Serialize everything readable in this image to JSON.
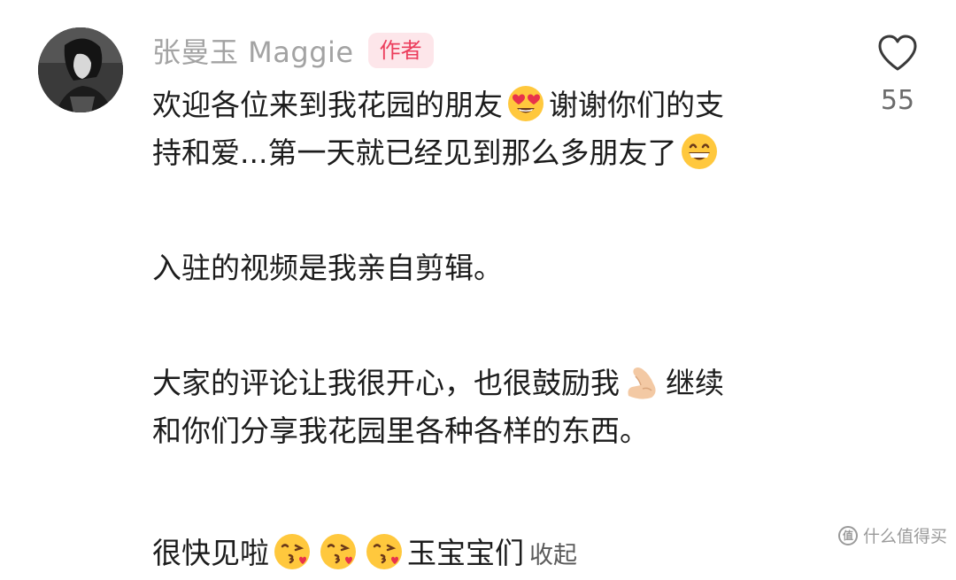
{
  "comment": {
    "author": {
      "name": "张曼玉 Maggie",
      "badge": "作者"
    },
    "lines": {
      "l1_a": "欢迎各位来到我花园的朋友",
      "l1_b": "谢谢你们的支",
      "l2": "持和爱...第一天就已经见到那么多朋友了",
      "l3": "入驻的视频是我亲自剪辑。",
      "l4_a": "大家的评论让我很开心，也很鼓励我",
      "l4_b": "继续",
      "l5": "和你们分享我花园里各种各样的东西。",
      "l6": "很快见啦",
      "l6_b": "玉宝宝们"
    },
    "emojis": {
      "heart_eyes": "heart-eyes-emoji",
      "grin": "grinning-emoji",
      "muscle": "flexed-biceps-emoji",
      "kiss": "kissing-heart-emoji"
    },
    "collapse_label": "收起",
    "like_count": "55"
  },
  "watermark": {
    "text": "什么值得买",
    "logo": "值"
  },
  "colors": {
    "name": "#a3a3a3",
    "badge_bg": "#fde6ea",
    "badge_text": "#ec3d5c",
    "body_text": "#1c1c1c"
  }
}
